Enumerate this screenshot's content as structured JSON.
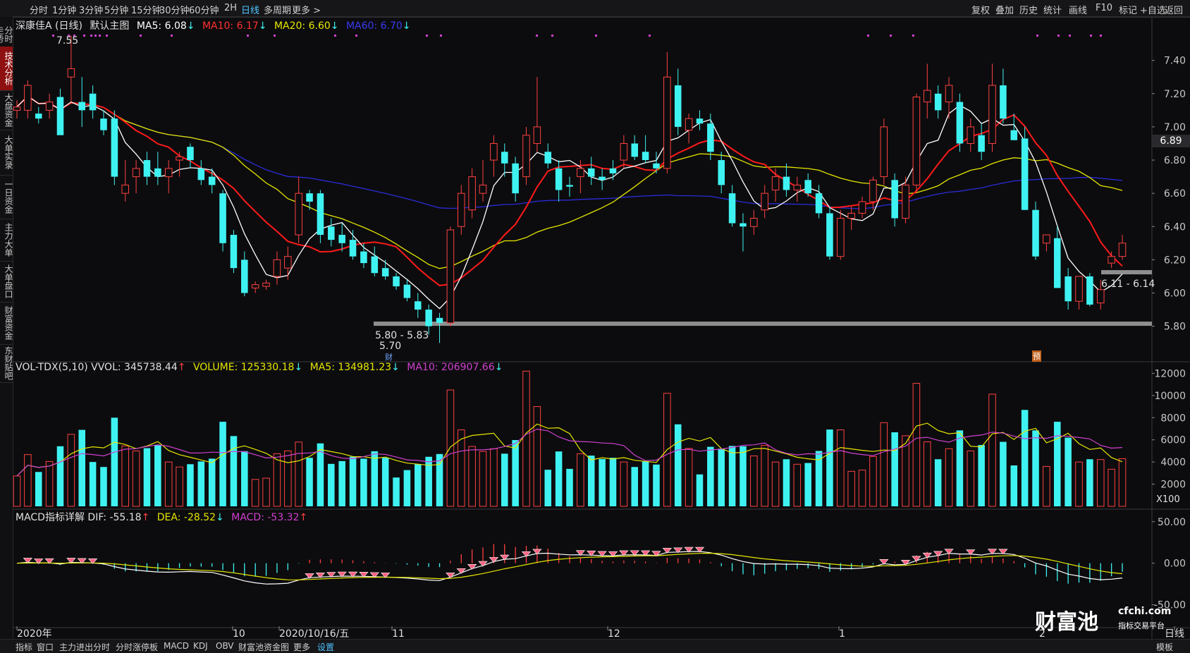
{
  "toolbar": {
    "periods": [
      "分时",
      "1分钟",
      "3分钟",
      "5分钟",
      "15分钟",
      "30分钟",
      "60分钟",
      "2H",
      "日线",
      "多周期",
      "更多 >"
    ],
    "active_period": "日线",
    "right_buttons": [
      "复权",
      "叠加",
      "历史",
      "统计",
      "画线",
      "F10",
      "标记",
      "+自选",
      "返回"
    ]
  },
  "side_tabs": [
    "分时走势",
    "技术分析",
    "大盘资金",
    "大单实录",
    "一日资金",
    "主力大单",
    "大单盘口",
    "财富资金",
    "东财贴吧"
  ],
  "active_side_tab": "技术分析",
  "main_legend": {
    "stock": "深康佳A (日线)",
    "template": "默认主图",
    "ma5": "MA5: 6.08",
    "ma10": "MA10: 6.17",
    "ma20": "MA20: 6.60",
    "ma60": "MA60: 6.70",
    "arrow_down": "↓"
  },
  "volume_legend": {
    "title": "VOL-TDX(5,10) VVOL: 345738.44",
    "volume": "VOLUME: 125330.18",
    "ma5": "MA5: 134981.23",
    "ma10": "MA10: 206907.66",
    "arrow_up": "↑",
    "arrow_down": "↓"
  },
  "macd_legend": {
    "title": "MACD指标详解 DIF: -55.18",
    "dea": "DEA: -28.52",
    "macd": "MACD: -53.32",
    "arrow_up": "↑",
    "arrow_down": "↓"
  },
  "annotations": {
    "high": "7.55",
    "support_range": "5.80 - 5.83",
    "low": "5.70",
    "recent_range": "6.11 - 6.14",
    "cai_badge": "财",
    "yu_badge": "预",
    "last_price": "6.89",
    "vol_unit": "X100"
  },
  "price_axis": [
    "7.40",
    "7.20",
    "7.00",
    "6.80",
    "6.60",
    "6.40",
    "6.20",
    "6.00",
    "5.80"
  ],
  "vol_axis": [
    "12000",
    "10000",
    "8000",
    "6000",
    "4000",
    "2000"
  ],
  "macd_axis": [
    "50.00",
    "0.00",
    "-50.00"
  ],
  "date_axis": [
    {
      "label": "2020年"
    },
    {
      "label": "10"
    },
    {
      "label": "2020/10/16/五"
    },
    {
      "label": "11"
    },
    {
      "label": "12"
    },
    {
      "label": "1"
    },
    {
      "label": "2"
    },
    {
      "label": "日线"
    }
  ],
  "bottom_tabs": [
    "指标",
    "窗口",
    "主力进出分时",
    "分时涨停板",
    "MACD",
    "KDJ",
    "OBV",
    "财富池资金图",
    "更多",
    "设置"
  ],
  "bottom_active": "设置",
  "bottom_right": "模板",
  "watermark": {
    "brand": "财富池",
    "domain": "cfchi.com",
    "tagline": "指标交易平台"
  },
  "colors": {
    "up": "#ff4040",
    "down": "#3ff2f2",
    "ma5": "#ffffff",
    "ma10": "#ff1a1a",
    "ma20": "#e6e600",
    "ma60": "#2b2bd9",
    "macd_label": "#d040d0",
    "active_tab": "#4fc3ff"
  },
  "chart_data": {
    "type": "candlestick",
    "y_range": [
      5.7,
      7.55
    ],
    "candles": [
      [
        7.1,
        7.16,
        7.05,
        7.12
      ],
      [
        7.1,
        7.28,
        7.05,
        7.25
      ],
      [
        7.08,
        7.12,
        7.02,
        7.05
      ],
      [
        7.1,
        7.2,
        7.05,
        7.15
      ],
      [
        7.18,
        7.23,
        7.0,
        6.95
      ],
      [
        7.3,
        7.55,
        7.15,
        7.35
      ],
      [
        7.15,
        7.3,
        7.0,
        7.1
      ],
      [
        7.2,
        7.25,
        7.05,
        7.1
      ],
      [
        7.05,
        7.1,
        6.95,
        6.98
      ],
      [
        7.05,
        7.1,
        6.65,
        6.7
      ],
      [
        6.6,
        6.8,
        6.55,
        6.65
      ],
      [
        6.7,
        6.8,
        6.6,
        6.75
      ],
      [
        6.8,
        6.85,
        6.65,
        6.7
      ],
      [
        6.75,
        6.85,
        6.65,
        6.7
      ],
      [
        6.7,
        6.8,
        6.6,
        6.75
      ],
      [
        6.8,
        6.85,
        6.7,
        6.82
      ],
      [
        6.88,
        6.9,
        6.75,
        6.8
      ],
      [
        6.75,
        6.8,
        6.65,
        6.68
      ],
      [
        6.7,
        6.75,
        6.6,
        6.65
      ],
      [
        6.6,
        6.62,
        6.25,
        6.3
      ],
      [
        6.35,
        6.38,
        6.12,
        6.15
      ],
      [
        6.2,
        6.25,
        5.98,
        6.0
      ],
      [
        6.03,
        6.07,
        6.0,
        6.05
      ],
      [
        6.04,
        6.08,
        6.02,
        6.06
      ],
      [
        6.1,
        6.25,
        6.05,
        6.2
      ],
      [
        6.15,
        6.28,
        6.08,
        6.22
      ],
      [
        6.35,
        6.7,
        6.3,
        6.6
      ],
      [
        6.6,
        6.62,
        6.5,
        6.55
      ],
      [
        6.6,
        6.62,
        6.3,
        6.35
      ],
      [
        6.4,
        6.45,
        6.28,
        6.32
      ],
      [
        6.35,
        6.42,
        6.25,
        6.3
      ],
      [
        6.32,
        6.38,
        6.2,
        6.22
      ],
      [
        6.25,
        6.3,
        6.15,
        6.18
      ],
      [
        6.22,
        6.28,
        6.1,
        6.12
      ],
      [
        6.15,
        6.2,
        6.08,
        6.1
      ],
      [
        6.1,
        6.12,
        6.02,
        6.04
      ],
      [
        6.05,
        6.08,
        5.95,
        5.97
      ],
      [
        5.95,
        6.0,
        5.85,
        5.9
      ],
      [
        5.9,
        5.93,
        5.75,
        5.8
      ],
      [
        5.85,
        5.88,
        5.7,
        5.82
      ],
      [
        5.82,
        6.4,
        5.8,
        6.38
      ],
      [
        6.4,
        6.65,
        6.35,
        6.6
      ],
      [
        6.5,
        6.75,
        6.45,
        6.7
      ],
      [
        6.6,
        6.8,
        6.55,
        6.65
      ],
      [
        6.8,
        6.95,
        6.7,
        6.9
      ],
      [
        6.85,
        6.9,
        6.7,
        6.78
      ],
      [
        6.78,
        6.82,
        6.55,
        6.6
      ],
      [
        6.7,
        7.0,
        6.65,
        6.95
      ],
      [
        6.9,
        7.3,
        6.85,
        7.0
      ],
      [
        6.85,
        6.9,
        6.75,
        6.78
      ],
      [
        6.75,
        6.8,
        6.55,
        6.62
      ],
      [
        6.65,
        6.7,
        6.58,
        6.64
      ],
      [
        6.7,
        6.8,
        6.6,
        6.75
      ],
      [
        6.75,
        6.82,
        6.65,
        6.7
      ],
      [
        6.7,
        6.75,
        6.62,
        6.68
      ],
      [
        6.75,
        6.8,
        6.68,
        6.72
      ],
      [
        6.8,
        6.95,
        6.75,
        6.9
      ],
      [
        6.9,
        6.95,
        6.8,
        6.82
      ],
      [
        6.85,
        6.95,
        6.78,
        6.8
      ],
      [
        6.78,
        6.85,
        6.72,
        6.75
      ],
      [
        6.75,
        7.45,
        6.72,
        7.3
      ],
      [
        7.25,
        7.35,
        6.95,
        7.0
      ],
      [
        6.98,
        7.08,
        6.9,
        7.05
      ],
      [
        7.05,
        7.1,
        6.98,
        7.02
      ],
      [
        7.02,
        7.08,
        6.8,
        6.85
      ],
      [
        6.8,
        6.85,
        6.6,
        6.65
      ],
      [
        6.6,
        6.65,
        6.4,
        6.42
      ],
      [
        6.42,
        6.48,
        6.25,
        6.4
      ],
      [
        6.4,
        6.5,
        6.35,
        6.45
      ],
      [
        6.5,
        6.65,
        6.45,
        6.6
      ],
      [
        6.62,
        6.75,
        6.55,
        6.7
      ],
      [
        6.7,
        6.78,
        6.58,
        6.62
      ],
      [
        6.62,
        6.7,
        6.55,
        6.65
      ],
      [
        6.68,
        6.72,
        6.58,
        6.6
      ],
      [
        6.6,
        6.65,
        6.45,
        6.48
      ],
      [
        6.48,
        6.52,
        6.2,
        6.22
      ],
      [
        6.22,
        6.5,
        6.2,
        6.45
      ],
      [
        6.45,
        6.52,
        6.38,
        6.48
      ],
      [
        6.48,
        6.58,
        6.45,
        6.55
      ],
      [
        6.55,
        6.7,
        6.5,
        6.68
      ],
      [
        6.7,
        7.05,
        6.65,
        7.0
      ],
      [
        6.68,
        6.72,
        6.4,
        6.45
      ],
      [
        6.45,
        6.7,
        6.42,
        6.65
      ],
      [
        6.65,
        7.2,
        6.6,
        7.18
      ],
      [
        7.15,
        7.38,
        7.05,
        7.22
      ],
      [
        7.2,
        7.25,
        7.05,
        7.1
      ],
      [
        7.15,
        7.3,
        7.05,
        7.25
      ],
      [
        7.15,
        7.2,
        6.85,
        6.9
      ],
      [
        6.9,
        7.05,
        6.85,
        7.0
      ],
      [
        6.95,
        7.02,
        6.8,
        6.85
      ],
      [
        6.9,
        7.38,
        6.85,
        7.25
      ],
      [
        7.25,
        7.35,
        7.02,
        7.05
      ],
      [
        6.98,
        7.08,
        6.92,
        6.92
      ],
      [
        6.93,
        7.0,
        6.5,
        6.5
      ],
      [
        6.5,
        6.55,
        6.2,
        6.22
      ],
      [
        6.3,
        6.35,
        6.25,
        6.35
      ],
      [
        6.33,
        6.4,
        6.03,
        6.03
      ],
      [
        6.1,
        6.15,
        5.9,
        5.95
      ],
      [
        5.95,
        6.1,
        5.9,
        6.1
      ],
      [
        6.1,
        6.12,
        5.92,
        5.93
      ],
      [
        5.94,
        6.08,
        5.9,
        6.02
      ],
      [
        6.18,
        6.25,
        6.15,
        6.22
      ],
      [
        6.22,
        6.35,
        6.2,
        6.3
      ]
    ]
  }
}
